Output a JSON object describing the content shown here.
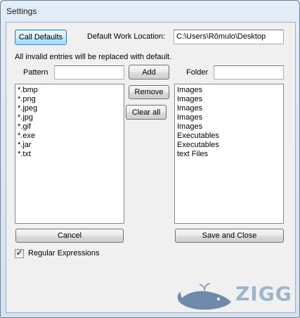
{
  "window": {
    "title": "Settings"
  },
  "top": {
    "call_defaults": "Call Defaults",
    "default_work_location_label": "Default Work Location:",
    "default_work_location_value": "C:\\Users\\Rômulo\\Desktop",
    "info": "All invalid entries will be replaced with default."
  },
  "pattern": {
    "label": "Pattern",
    "value": ""
  },
  "folder": {
    "label": "Folder",
    "value": ""
  },
  "buttons": {
    "add": "Add",
    "remove": "Remove",
    "clear_all": "Clear all",
    "cancel": "Cancel",
    "save_close": "Save and Close"
  },
  "patterns_list": [
    "*.bmp",
    "*.png",
    "*.jpeg",
    "*.jpg",
    "*.gif",
    "*.exe",
    "*.jar",
    "*.txt"
  ],
  "folders_list": [
    "Images",
    "Images",
    "Images",
    "Images",
    "Images",
    "Executables",
    "Executables",
    "text Files"
  ],
  "regex": {
    "label": "Regular Expressions",
    "checked": true
  },
  "watermark": {
    "text": "ZIGG",
    "icon": "whale-icon"
  }
}
